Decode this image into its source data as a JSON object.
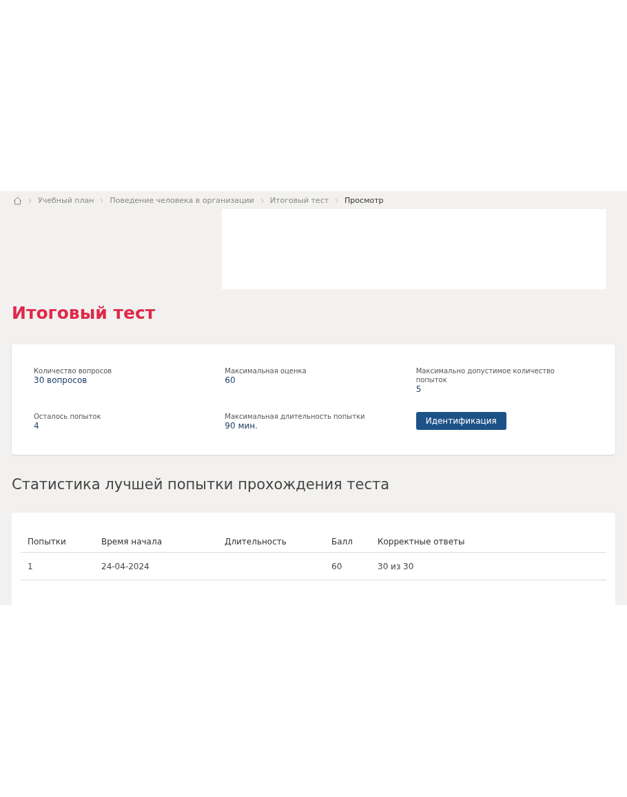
{
  "breadcrumbs": [
    {
      "label": "Учебный план",
      "current": false
    },
    {
      "label": "Поведение человека в организации",
      "current": false
    },
    {
      "label": "Итоговый тест",
      "current": false
    },
    {
      "label": "Просмотр",
      "current": true
    }
  ],
  "title": "Итоговый тест",
  "info": [
    {
      "kind": "field",
      "label": "Количество вопросов",
      "value": "30 вопросов"
    },
    {
      "kind": "field",
      "label": "Максимальная оценка",
      "value": "60"
    },
    {
      "kind": "field",
      "label": "Максимально допустимое количество попыток",
      "value": "5"
    },
    {
      "kind": "field",
      "label": "Осталось попыток",
      "value": "4"
    },
    {
      "kind": "field",
      "label": "Максимальная длительность попытки",
      "value": "90 мин."
    },
    {
      "kind": "button",
      "label": "Идентификация"
    }
  ],
  "stats_heading": "Статистика лучшей попытки прохождения теста",
  "table": {
    "columns": [
      "Попытки",
      "Время начала",
      "Длительность",
      "Балл",
      "Корректные ответы"
    ],
    "rows": [
      [
        "1",
        "24-04-2024",
        "",
        "60",
        "30 из 30"
      ]
    ]
  }
}
